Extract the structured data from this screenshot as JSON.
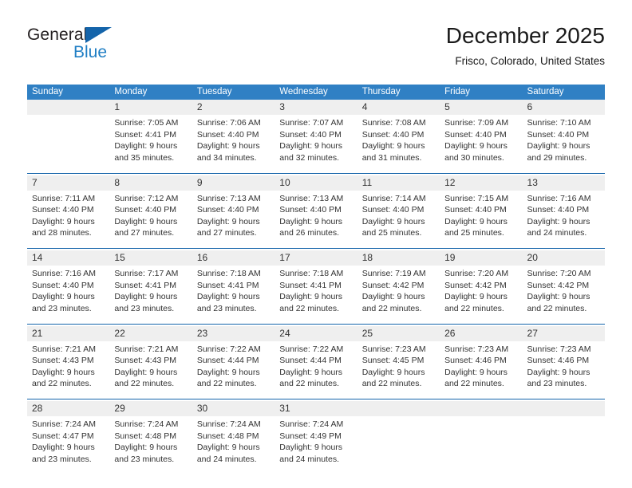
{
  "brand": {
    "name_part1": "General",
    "name_part2": "Blue",
    "triangle_icon": "blue-triangle-icon",
    "accent_color": "#1464aa"
  },
  "header": {
    "title": "December 2025",
    "subtitle": "Frisco, Colorado, United States"
  },
  "colors": {
    "header_row_bg": "#3080c4",
    "date_band_bg": "#efefef",
    "separator": "#1464aa",
    "text": "#333333"
  },
  "calendar": {
    "weekdays": [
      "Sunday",
      "Monday",
      "Tuesday",
      "Wednesday",
      "Thursday",
      "Friday",
      "Saturday"
    ],
    "labels": {
      "sunrise": "Sunrise:",
      "sunset": "Sunset:",
      "daylight": "Daylight:"
    },
    "weeks": [
      {
        "days": [
          {
            "date": "",
            "sunrise": "",
            "sunset": "",
            "daylight_line1": "",
            "daylight_line2": ""
          },
          {
            "date": "1",
            "sunrise": "Sunrise: 7:05 AM",
            "sunset": "Sunset: 4:41 PM",
            "daylight_line1": "Daylight: 9 hours",
            "daylight_line2": "and 35 minutes."
          },
          {
            "date": "2",
            "sunrise": "Sunrise: 7:06 AM",
            "sunset": "Sunset: 4:40 PM",
            "daylight_line1": "Daylight: 9 hours",
            "daylight_line2": "and 34 minutes."
          },
          {
            "date": "3",
            "sunrise": "Sunrise: 7:07 AM",
            "sunset": "Sunset: 4:40 PM",
            "daylight_line1": "Daylight: 9 hours",
            "daylight_line2": "and 32 minutes."
          },
          {
            "date": "4",
            "sunrise": "Sunrise: 7:08 AM",
            "sunset": "Sunset: 4:40 PM",
            "daylight_line1": "Daylight: 9 hours",
            "daylight_line2": "and 31 minutes."
          },
          {
            "date": "5",
            "sunrise": "Sunrise: 7:09 AM",
            "sunset": "Sunset: 4:40 PM",
            "daylight_line1": "Daylight: 9 hours",
            "daylight_line2": "and 30 minutes."
          },
          {
            "date": "6",
            "sunrise": "Sunrise: 7:10 AM",
            "sunset": "Sunset: 4:40 PM",
            "daylight_line1": "Daylight: 9 hours",
            "daylight_line2": "and 29 minutes."
          }
        ]
      },
      {
        "days": [
          {
            "date": "7",
            "sunrise": "Sunrise: 7:11 AM",
            "sunset": "Sunset: 4:40 PM",
            "daylight_line1": "Daylight: 9 hours",
            "daylight_line2": "and 28 minutes."
          },
          {
            "date": "8",
            "sunrise": "Sunrise: 7:12 AM",
            "sunset": "Sunset: 4:40 PM",
            "daylight_line1": "Daylight: 9 hours",
            "daylight_line2": "and 27 minutes."
          },
          {
            "date": "9",
            "sunrise": "Sunrise: 7:13 AM",
            "sunset": "Sunset: 4:40 PM",
            "daylight_line1": "Daylight: 9 hours",
            "daylight_line2": "and 27 minutes."
          },
          {
            "date": "10",
            "sunrise": "Sunrise: 7:13 AM",
            "sunset": "Sunset: 4:40 PM",
            "daylight_line1": "Daylight: 9 hours",
            "daylight_line2": "and 26 minutes."
          },
          {
            "date": "11",
            "sunrise": "Sunrise: 7:14 AM",
            "sunset": "Sunset: 4:40 PM",
            "daylight_line1": "Daylight: 9 hours",
            "daylight_line2": "and 25 minutes."
          },
          {
            "date": "12",
            "sunrise": "Sunrise: 7:15 AM",
            "sunset": "Sunset: 4:40 PM",
            "daylight_line1": "Daylight: 9 hours",
            "daylight_line2": "and 25 minutes."
          },
          {
            "date": "13",
            "sunrise": "Sunrise: 7:16 AM",
            "sunset": "Sunset: 4:40 PM",
            "daylight_line1": "Daylight: 9 hours",
            "daylight_line2": "and 24 minutes."
          }
        ]
      },
      {
        "days": [
          {
            "date": "14",
            "sunrise": "Sunrise: 7:16 AM",
            "sunset": "Sunset: 4:40 PM",
            "daylight_line1": "Daylight: 9 hours",
            "daylight_line2": "and 23 minutes."
          },
          {
            "date": "15",
            "sunrise": "Sunrise: 7:17 AM",
            "sunset": "Sunset: 4:41 PM",
            "daylight_line1": "Daylight: 9 hours",
            "daylight_line2": "and 23 minutes."
          },
          {
            "date": "16",
            "sunrise": "Sunrise: 7:18 AM",
            "sunset": "Sunset: 4:41 PM",
            "daylight_line1": "Daylight: 9 hours",
            "daylight_line2": "and 23 minutes."
          },
          {
            "date": "17",
            "sunrise": "Sunrise: 7:18 AM",
            "sunset": "Sunset: 4:41 PM",
            "daylight_line1": "Daylight: 9 hours",
            "daylight_line2": "and 22 minutes."
          },
          {
            "date": "18",
            "sunrise": "Sunrise: 7:19 AM",
            "sunset": "Sunset: 4:42 PM",
            "daylight_line1": "Daylight: 9 hours",
            "daylight_line2": "and 22 minutes."
          },
          {
            "date": "19",
            "sunrise": "Sunrise: 7:20 AM",
            "sunset": "Sunset: 4:42 PM",
            "daylight_line1": "Daylight: 9 hours",
            "daylight_line2": "and 22 minutes."
          },
          {
            "date": "20",
            "sunrise": "Sunrise: 7:20 AM",
            "sunset": "Sunset: 4:42 PM",
            "daylight_line1": "Daylight: 9 hours",
            "daylight_line2": "and 22 minutes."
          }
        ]
      },
      {
        "days": [
          {
            "date": "21",
            "sunrise": "Sunrise: 7:21 AM",
            "sunset": "Sunset: 4:43 PM",
            "daylight_line1": "Daylight: 9 hours",
            "daylight_line2": "and 22 minutes."
          },
          {
            "date": "22",
            "sunrise": "Sunrise: 7:21 AM",
            "sunset": "Sunset: 4:43 PM",
            "daylight_line1": "Daylight: 9 hours",
            "daylight_line2": "and 22 minutes."
          },
          {
            "date": "23",
            "sunrise": "Sunrise: 7:22 AM",
            "sunset": "Sunset: 4:44 PM",
            "daylight_line1": "Daylight: 9 hours",
            "daylight_line2": "and 22 minutes."
          },
          {
            "date": "24",
            "sunrise": "Sunrise: 7:22 AM",
            "sunset": "Sunset: 4:44 PM",
            "daylight_line1": "Daylight: 9 hours",
            "daylight_line2": "and 22 minutes."
          },
          {
            "date": "25",
            "sunrise": "Sunrise: 7:23 AM",
            "sunset": "Sunset: 4:45 PM",
            "daylight_line1": "Daylight: 9 hours",
            "daylight_line2": "and 22 minutes."
          },
          {
            "date": "26",
            "sunrise": "Sunrise: 7:23 AM",
            "sunset": "Sunset: 4:46 PM",
            "daylight_line1": "Daylight: 9 hours",
            "daylight_line2": "and 22 minutes."
          },
          {
            "date": "27",
            "sunrise": "Sunrise: 7:23 AM",
            "sunset": "Sunset: 4:46 PM",
            "daylight_line1": "Daylight: 9 hours",
            "daylight_line2": "and 23 minutes."
          }
        ]
      },
      {
        "days": [
          {
            "date": "28",
            "sunrise": "Sunrise: 7:24 AM",
            "sunset": "Sunset: 4:47 PM",
            "daylight_line1": "Daylight: 9 hours",
            "daylight_line2": "and 23 minutes."
          },
          {
            "date": "29",
            "sunrise": "Sunrise: 7:24 AM",
            "sunset": "Sunset: 4:48 PM",
            "daylight_line1": "Daylight: 9 hours",
            "daylight_line2": "and 23 minutes."
          },
          {
            "date": "30",
            "sunrise": "Sunrise: 7:24 AM",
            "sunset": "Sunset: 4:48 PM",
            "daylight_line1": "Daylight: 9 hours",
            "daylight_line2": "and 24 minutes."
          },
          {
            "date": "31",
            "sunrise": "Sunrise: 7:24 AM",
            "sunset": "Sunset: 4:49 PM",
            "daylight_line1": "Daylight: 9 hours",
            "daylight_line2": "and 24 minutes."
          },
          {
            "date": "",
            "sunrise": "",
            "sunset": "",
            "daylight_line1": "",
            "daylight_line2": ""
          },
          {
            "date": "",
            "sunrise": "",
            "sunset": "",
            "daylight_line1": "",
            "daylight_line2": ""
          },
          {
            "date": "",
            "sunrise": "",
            "sunset": "",
            "daylight_line1": "",
            "daylight_line2": ""
          }
        ]
      }
    ]
  }
}
